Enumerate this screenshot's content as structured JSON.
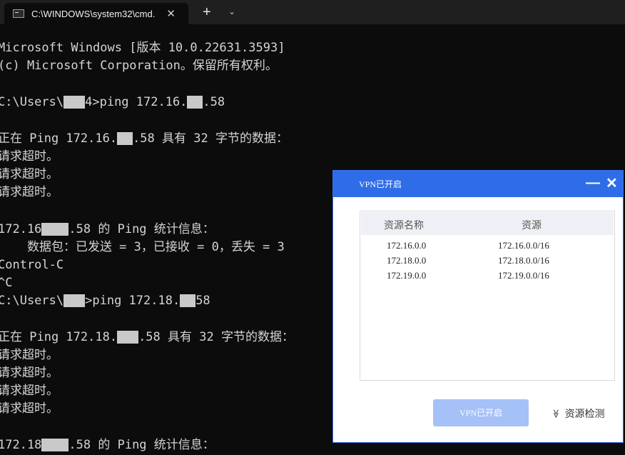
{
  "tabbar": {
    "tab_title": "C:\\WINDOWS\\system32\\cmd.",
    "close_glyph": "✕",
    "new_tab_glyph": "+",
    "dropdown_glyph": "⌄"
  },
  "terminal": {
    "lines": [
      "Microsoft Windows [版本 10.0.22631.3593]",
      "(c) Microsoft Corporation。保留所有权利。",
      "",
      "C:\\Users\\",
      "4>ping 172.16.",
      ".58",
      "正在 Ping 172.16.",
      ".58 具有 32 字节的数据：",
      "请求超时。",
      "请求超时。",
      "请求超时。",
      "172.16",
      ".58 的 Ping 统计信息：",
      "    数据包：已发送 = 3，已接收 = 0，丢失 = 3",
      "Control-C",
      "^C",
      "C:\\Users\\",
      ">ping 172.18.",
      "58",
      "正在 Ping 172.18.",
      ".58 具有 32 字节的数据：",
      "请求超时。",
      "请求超时。",
      "请求超时。",
      "请求超时。",
      "172.18",
      ".58 的 Ping 统计信息："
    ]
  },
  "dialog": {
    "title": "VPN已开启",
    "minimize_glyph": "—",
    "close_glyph": "✕",
    "table": {
      "headers": [
        "资源名称",
        "资源"
      ],
      "rows": [
        [
          "172.16.0.0",
          "172.16.0.0/16"
        ],
        [
          "172.18.0.0",
          "172.18.0.0/16"
        ],
        [
          "172.19.0.0",
          "172.19.0.0/16"
        ]
      ]
    },
    "vpn_button": "VPN已开启",
    "check_label": "资源检测",
    "check_icon_glyph": "≫"
  }
}
